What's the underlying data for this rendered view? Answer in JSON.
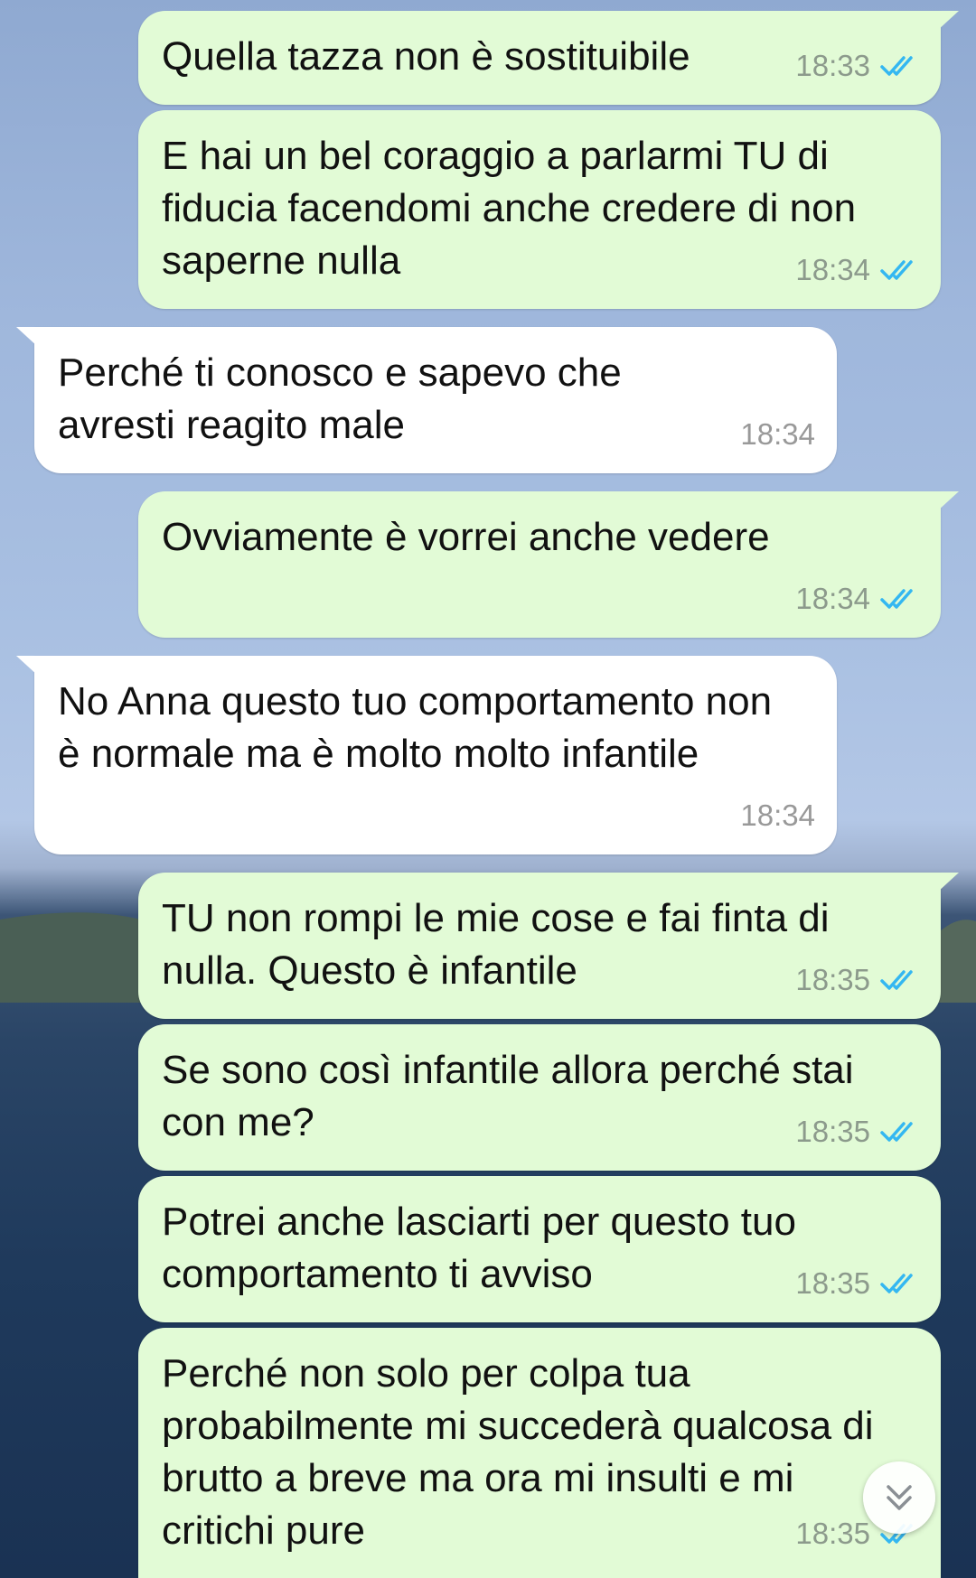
{
  "colors": {
    "outgoing_bubble": "#e2fbd6",
    "incoming_bubble": "#ffffff",
    "read_ticks": "#34b7f1",
    "timestamp": "#8c9a8c"
  },
  "icons": {
    "read_receipt": "double-check-icon",
    "scroll_down": "chevron-double-down-icon"
  },
  "messages": [
    {
      "direction": "outgoing",
      "text": "Quella tazza non è sostituibile",
      "time": "18:33",
      "read": true
    },
    {
      "direction": "outgoing",
      "text": "E hai un bel coraggio a parlarmi TU di fiducia facendomi anche credere di non saperne nulla",
      "time": "18:34",
      "read": true
    },
    {
      "direction": "incoming",
      "text": "Perché ti conosco e sapevo che avresti reagito male",
      "time": "18:34"
    },
    {
      "direction": "outgoing",
      "text": "Ovviamente è vorrei anche vedere",
      "time": "18:34",
      "read": true
    },
    {
      "direction": "incoming",
      "text": "No Anna questo tuo comportamento non è normale ma è molto molto infantile",
      "time": "18:34"
    },
    {
      "direction": "outgoing",
      "text": "TU non rompi le mie cose e fai finta di nulla. Questo è infantile",
      "time": "18:35",
      "read": true
    },
    {
      "direction": "outgoing",
      "text": "Se sono così infantile allora perché stai con me?",
      "time": "18:35",
      "read": true
    },
    {
      "direction": "outgoing",
      "text": "Potrei anche lasciarti per questo tuo comportamento ti avviso",
      "time": "18:35",
      "read": true
    },
    {
      "direction": "outgoing",
      "text": "Perché non solo per colpa tua probabilmente mi succederà qualcosa di brutto a breve ma ora mi insulti e mi critichi pure",
      "time": "18:35",
      "read": true
    }
  ]
}
